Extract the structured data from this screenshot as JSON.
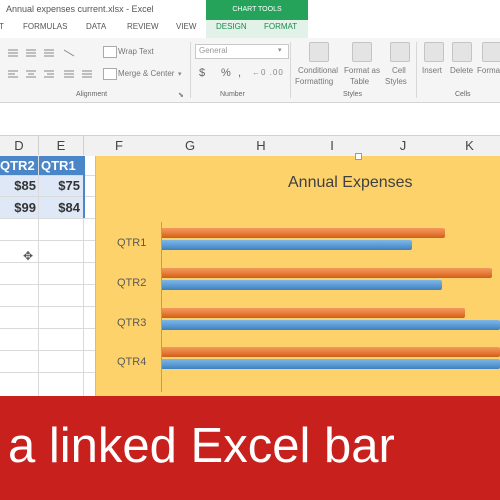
{
  "window": {
    "title": "Annual expenses current.xlsx - Excel",
    "chart_tools": "CHART TOOLS"
  },
  "tabs": [
    {
      "label": "T"
    },
    {
      "label": "FORMULAS"
    },
    {
      "label": "DATA"
    },
    {
      "label": "REVIEW"
    },
    {
      "label": "VIEW"
    },
    {
      "label": "DESIGN"
    },
    {
      "label": "FORMAT"
    }
  ],
  "ribbon": {
    "wrap_text": "Wrap Text",
    "merge_center": "Merge & Center",
    "number_format": "General",
    "currency": "$",
    "percent": "%",
    "comma": ",",
    "alignment_label": "Alignment",
    "number_label": "Number",
    "styles_label": "Styles",
    "cells_label": "Cells",
    "conditional_formatting": [
      "Conditional",
      "Formatting"
    ],
    "format_as_table": [
      "Format as",
      "Table"
    ],
    "cell_styles": [
      "Cell",
      "Styles"
    ],
    "insert": "Insert",
    "delete": "Delete",
    "format": "Forma"
  },
  "sheet": {
    "columns": [
      "D",
      "E",
      "F",
      "G",
      "H",
      "I",
      "J",
      "K"
    ],
    "rows": [
      [
        "QTR2",
        "QTR1"
      ],
      [
        "$85",
        "$75"
      ],
      [
        "$99",
        "$84"
      ]
    ]
  },
  "chart_data": {
    "type": "bar",
    "orientation": "horizontal",
    "title": "Annual Expenses",
    "categories": [
      "QTR1",
      "QTR2",
      "QTR3",
      "QTR4"
    ],
    "series": [
      {
        "color": "#ed7d31",
        "values": [
          85,
          99,
          91,
          103
        ]
      },
      {
        "color": "#5b9bd5",
        "values": [
          75,
          84,
          105,
          104
        ]
      }
    ],
    "xlim": [
      0,
      102
    ],
    "grid": false
  },
  "banner": {
    "text": "a linked Excel bar",
    "color": "#c8211d"
  }
}
